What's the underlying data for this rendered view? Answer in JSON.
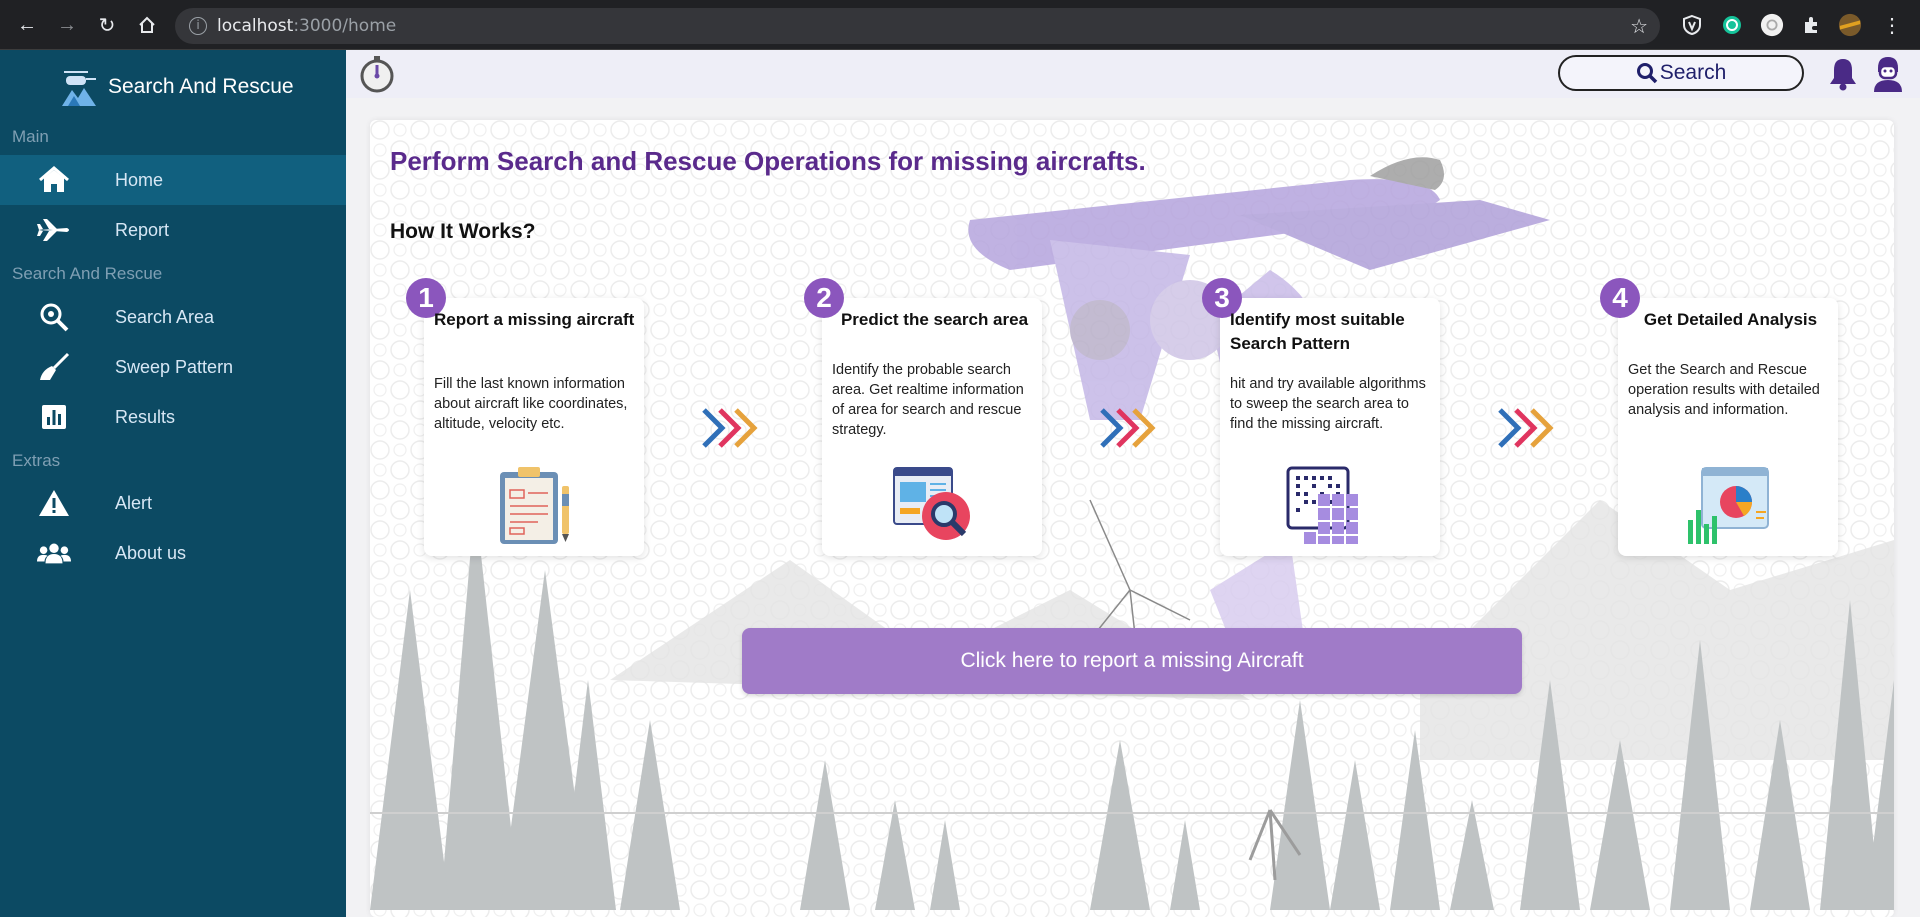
{
  "browser": {
    "url_host": "localhost",
    "url_path": ":3000/home"
  },
  "sidebar": {
    "brand": "Search And Rescue",
    "sections": [
      {
        "label": "Main"
      },
      {
        "label": "Search And Rescue"
      },
      {
        "label": "Extras"
      }
    ],
    "items": [
      {
        "label": "Home",
        "icon": "home-icon"
      },
      {
        "label": "Report",
        "icon": "airplane-icon"
      },
      {
        "label": "Search Area",
        "icon": "search-area-icon"
      },
      {
        "label": "Sweep Pattern",
        "icon": "broom-icon"
      },
      {
        "label": "Results",
        "icon": "chart-icon"
      },
      {
        "label": "Alert",
        "icon": "warning-icon"
      },
      {
        "label": "About us",
        "icon": "users-icon"
      }
    ]
  },
  "topbar": {
    "search_label": "Search"
  },
  "main": {
    "headline": "Perform Search and Rescue Operations for missing aircrafts.",
    "subhead": "How It Works?",
    "steps": [
      {
        "num": "1",
        "title": "Report a missing aircraft",
        "desc": "Fill the last known information about aircraft like coordinates, altitude, velocity etc."
      },
      {
        "num": "2",
        "title": "Predict the search area",
        "desc": "Identify the probable search area. Get realtime information of area for search and rescue strategy."
      },
      {
        "num": "3",
        "title": "Identify most suitable Search Pattern",
        "desc": "hit and try available algorithms to sweep the search area to find the missing aircraft."
      },
      {
        "num": "4",
        "title": "Get Detailed Analysis",
        "desc": "Get the Search and Rescue operation results with detailed analysis and information."
      }
    ],
    "cta": "Click here to report a missing Aircraft"
  },
  "colors": {
    "sidebar_bg": "#0c4a63",
    "sidebar_active": "#11607f",
    "accent_purple": "#5a2a8c",
    "cta_bg": "#a07bc8"
  }
}
